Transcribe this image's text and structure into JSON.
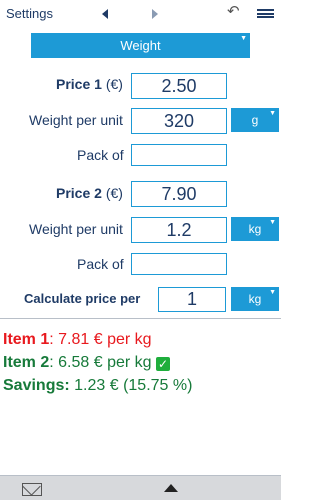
{
  "header": {
    "settings_label": "Settings",
    "prev_icon": "chevron-left-icon",
    "next_icon": "chevron-right-icon",
    "undo_icon": "undo-icon",
    "menu_icon": "hamburger-menu-icon"
  },
  "mode": {
    "selected": "Weight"
  },
  "item1": {
    "price_label": "Price 1",
    "currency": "(€)",
    "price_value": "2.50",
    "weight_label": "Weight per unit",
    "weight_value": "320",
    "weight_unit": "g",
    "pack_label": "Pack of",
    "pack_value": ""
  },
  "item2": {
    "price_label": "Price 2",
    "currency": "(€)",
    "price_value": "7.90",
    "weight_label": "Weight per unit",
    "weight_value": "1.2",
    "weight_unit": "kg",
    "pack_label": "Pack of",
    "pack_value": ""
  },
  "calc": {
    "label": "Calculate price per",
    "value": "1",
    "unit": "kg"
  },
  "results": {
    "item1_key": "Item 1",
    "item1_text": ": 7.81 € per kg",
    "item2_key": "Item 2",
    "item2_text": ": 6.58 € per kg",
    "item2_check": "✓",
    "savings_key": "Savings:",
    "savings_text": " 1.23 € (15.75 %)"
  },
  "footer": {
    "mail_icon": "mail-icon",
    "expand_icon": "arrow-up-icon"
  },
  "colors": {
    "accent": "#1d9ad6",
    "text": "#1f3b66",
    "worse": "#e8191e",
    "better": "#177a3a"
  }
}
